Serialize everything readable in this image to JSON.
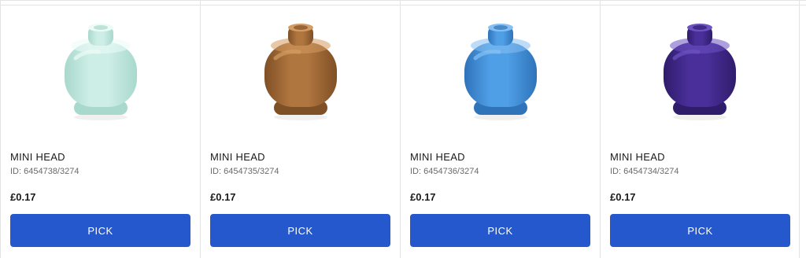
{
  "products": [
    {
      "name": "MINI HEAD",
      "id": "ID: 6454738/3274",
      "price": "£0.17",
      "button": "PICK",
      "color": "#cdeee6",
      "shade": "#a9d8cc",
      "highlight": "#ecfbf7"
    },
    {
      "name": "MINI HEAD",
      "id": "ID: 6454735/3274",
      "price": "£0.17",
      "button": "PICK",
      "color": "#b0763f",
      "shade": "#7f4f26",
      "highlight": "#d49b62"
    },
    {
      "name": "MINI HEAD",
      "id": "ID: 6454736/3274",
      "price": "£0.17",
      "button": "PICK",
      "color": "#4f9fe6",
      "shade": "#2f73b9",
      "highlight": "#86c0f3"
    },
    {
      "name": "MINI HEAD",
      "id": "ID: 6454734/3274",
      "price": "£0.17",
      "button": "PICK",
      "color": "#4a2f9a",
      "shade": "#2f1c6b",
      "highlight": "#6c52c2"
    }
  ]
}
